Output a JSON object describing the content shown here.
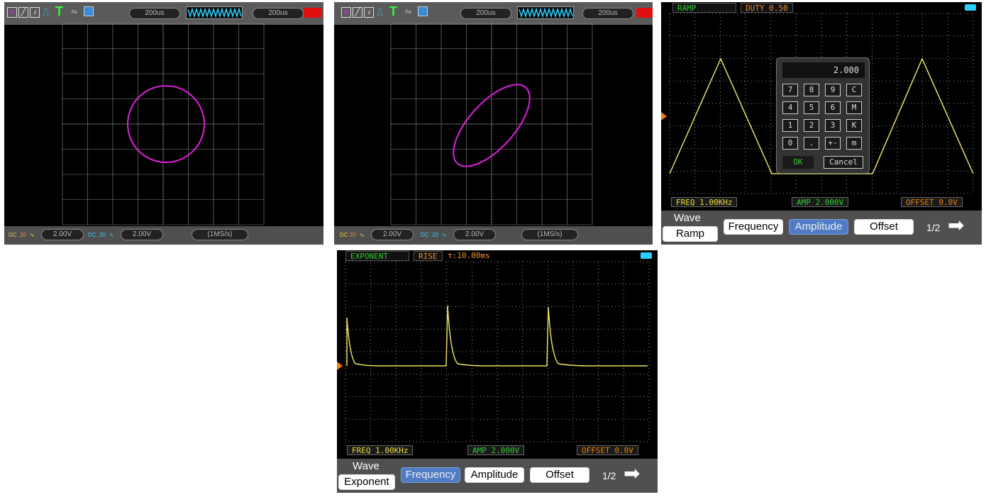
{
  "xy1": {
    "timebase_left": "200us",
    "timebase_right": "200us",
    "ch1_scale": "2.00V",
    "ch2_scale": "2.00V",
    "sample_rate": "(1MS/s)",
    "coupling": "DC",
    "bw": "20"
  },
  "xy2": {
    "timebase_left": "200us",
    "timebase_right": "200us",
    "ch1_scale": "2.00V",
    "ch2_scale": "2.00V",
    "sample_rate": "(1MS/s)",
    "coupling": "DC",
    "bw": "20"
  },
  "ramp": {
    "wave_tag": "RAMP",
    "duty_tag": "DUTY 0.50",
    "freq": "FREQ 1.00KHz",
    "amp": "AMP 2.000V",
    "offset": "OFFSET 0.0V",
    "menu": {
      "wave_label": "Wave",
      "wave_value": "Ramp",
      "frequency": "Frequency",
      "amplitude": "Amplitude",
      "offset": "Offset",
      "page": "1/2"
    },
    "keypad": {
      "display": "2.000",
      "keys": [
        "7",
        "8",
        "9",
        "C",
        "4",
        "5",
        "6",
        "M",
        "1",
        "2",
        "3",
        "K",
        "0",
        ".",
        "+-",
        "m"
      ],
      "ok": "OK",
      "cancel": "Cancel"
    }
  },
  "exponent": {
    "wave_tag": "EXPONENT",
    "rise_tag": "RISE",
    "tau_tag": "τ:10.00ms",
    "freq": "FREQ 1.00KHz",
    "amp": "AMP 2.000V",
    "offset": "OFFSET 0.0V",
    "menu": {
      "wave_label": "Wave",
      "wave_value": "Exponent",
      "frequency": "Frequency",
      "amplitude": "Amplitude",
      "offset": "Offset",
      "page": "1/2"
    }
  },
  "colors": {
    "trace_xy": "#e020e0",
    "trace_gen": "#e8e060",
    "grid": "#8a8a8a",
    "accent_blue": "#4f7cc5",
    "trigger_marker": "#f08000"
  },
  "icons": [
    "xy-mode-icon",
    "trigger-icon",
    "usb-icon",
    "save-icon",
    "waveform-icon",
    "arrow-right-icon",
    "battery-icon"
  ]
}
